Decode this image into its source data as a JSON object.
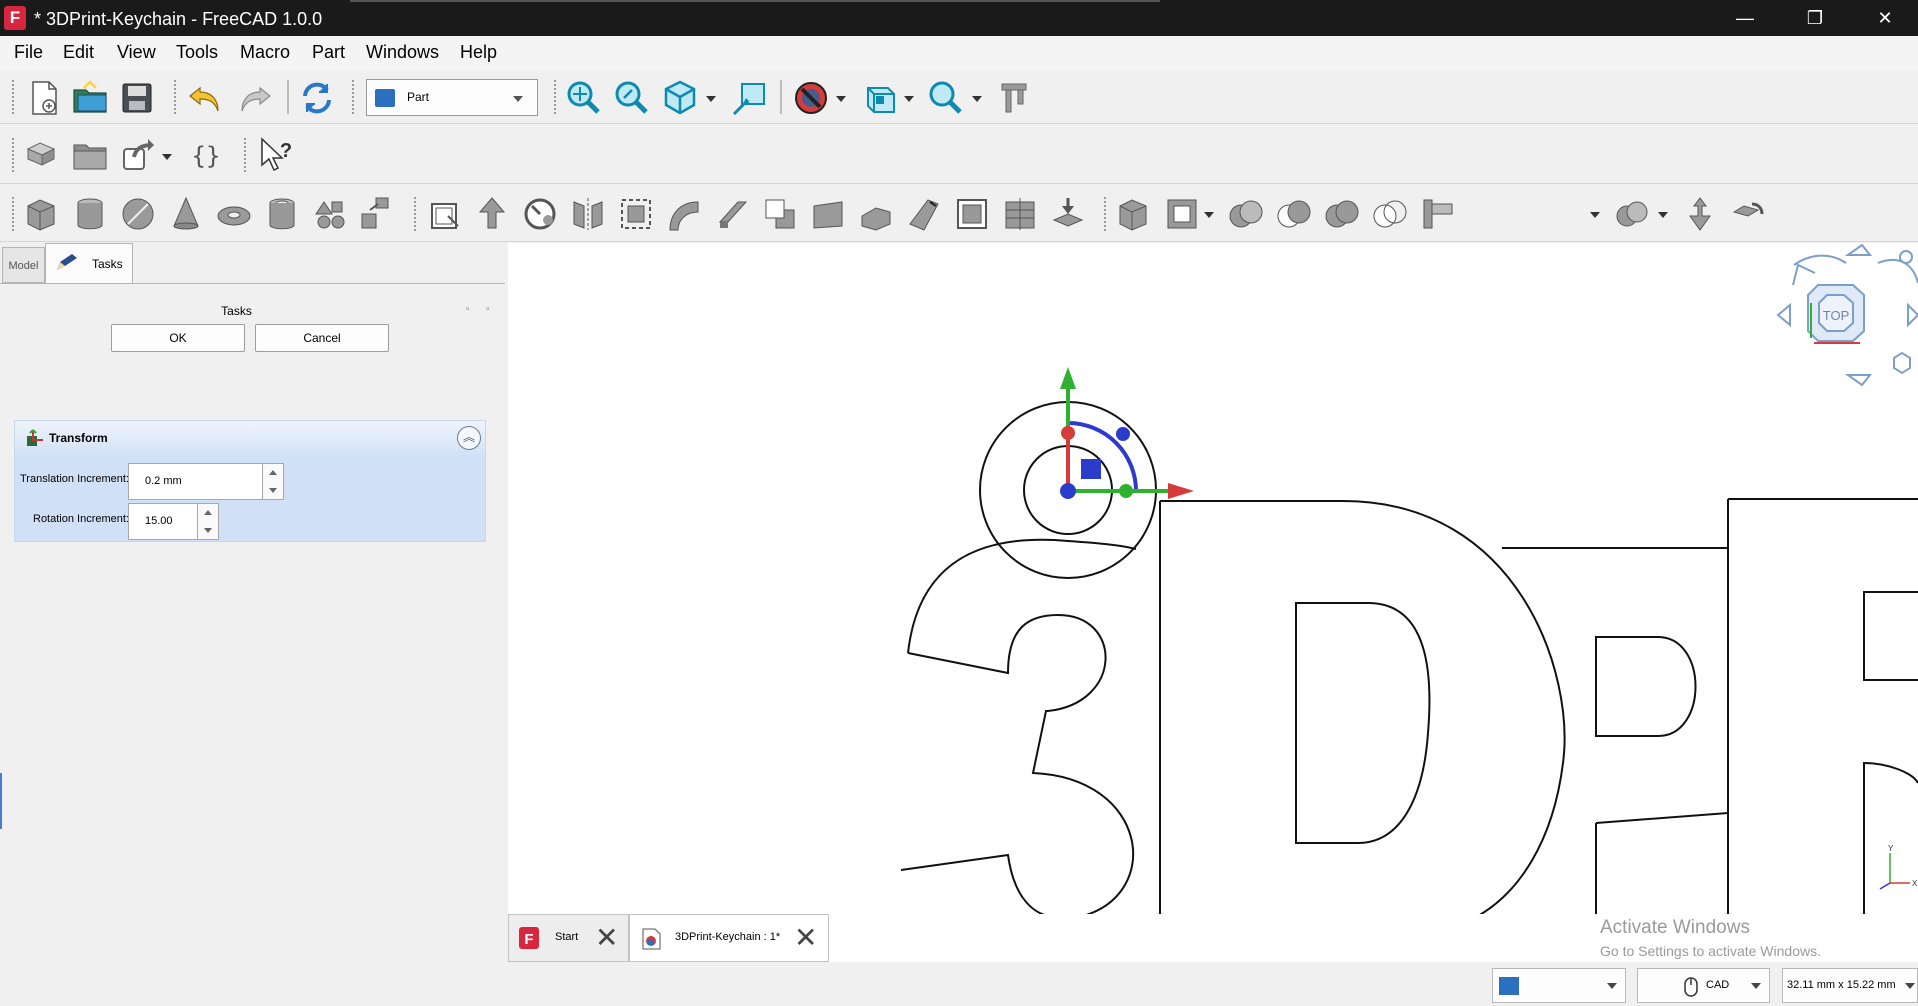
{
  "window": {
    "title": "* 3DPrint-Keychain - FreeCAD 1.0.0",
    "logo_letter": "F",
    "minimize": "—",
    "maximize": "❐",
    "close": "✕"
  },
  "menu": [
    "File",
    "Edit",
    "View",
    "Tools",
    "Macro",
    "Part",
    "Windows",
    "Help"
  ],
  "workbench_selector": {
    "value": "Part"
  },
  "left_panel": {
    "tabs": {
      "model": "Model",
      "tasks": "Tasks"
    },
    "title": "Tasks",
    "ok_label": "OK",
    "cancel_label": "Cancel",
    "transform": {
      "title": "Transform",
      "translation_label": "Translation Increment:",
      "translation_value": "0.2 mm",
      "rotation_label": "Rotation Increment:",
      "rotation_value": "15.00"
    }
  },
  "navcube": {
    "face": "TOP"
  },
  "axis_labels": {
    "y": "Y",
    "x": "X"
  },
  "doc_tabs": [
    {
      "label": "Start"
    },
    {
      "label": "3DPrint-Keychain : 1*"
    }
  ],
  "watermark": {
    "line1": "Activate Windows",
    "line2": "Go to Settings to activate Windows."
  },
  "status": {
    "nav_style": "CAD",
    "dimensions": "32.11 mm x 15.22 mm"
  },
  "colors": {
    "x_axis": "#d63a3a",
    "y_axis": "#2fb12f",
    "z_axis": "#2b3ccc",
    "titlebar": "#1a1a1a",
    "panel_highlight": "#cfe0f7"
  },
  "icons": {
    "toolbar1": [
      "new-document-icon",
      "open-document-icon",
      "save-icon",
      "undo-icon",
      "redo-icon",
      "refresh-icon",
      "fit-all-icon",
      "fit-selection-icon",
      "isometric-view-icon",
      "measure-icon",
      "draw-style-icon",
      "standard-views-icon",
      "zoom-icon",
      "caliper-icon"
    ],
    "toolbar2": [
      "part-icon",
      "group-icon",
      "link-icon",
      "expression-icon",
      "whats-this-icon"
    ],
    "toolbar3": [
      "box-icon",
      "cylinder-icon",
      "sphere-icon",
      "cone-icon",
      "torus-icon",
      "tube-icon",
      "primitives-icon",
      "shape-builder-icon",
      "extrude-icon",
      "revolve-icon",
      "mirror-icon",
      "fillet-icon",
      "chamfer-icon",
      "make-face-icon",
      "ruled-surface-icon",
      "loft-icon",
      "sweep-icon",
      "section-icon",
      "cross-section-icon",
      "offset-icon",
      "thickness-icon",
      "projection-icon",
      "compound-icon",
      "boolean-icon",
      "cut-icon",
      "fuse-icon",
      "common-icon",
      "join-icon",
      "split-icon",
      "check-geometry-icon",
      "defeaturing-icon"
    ]
  }
}
